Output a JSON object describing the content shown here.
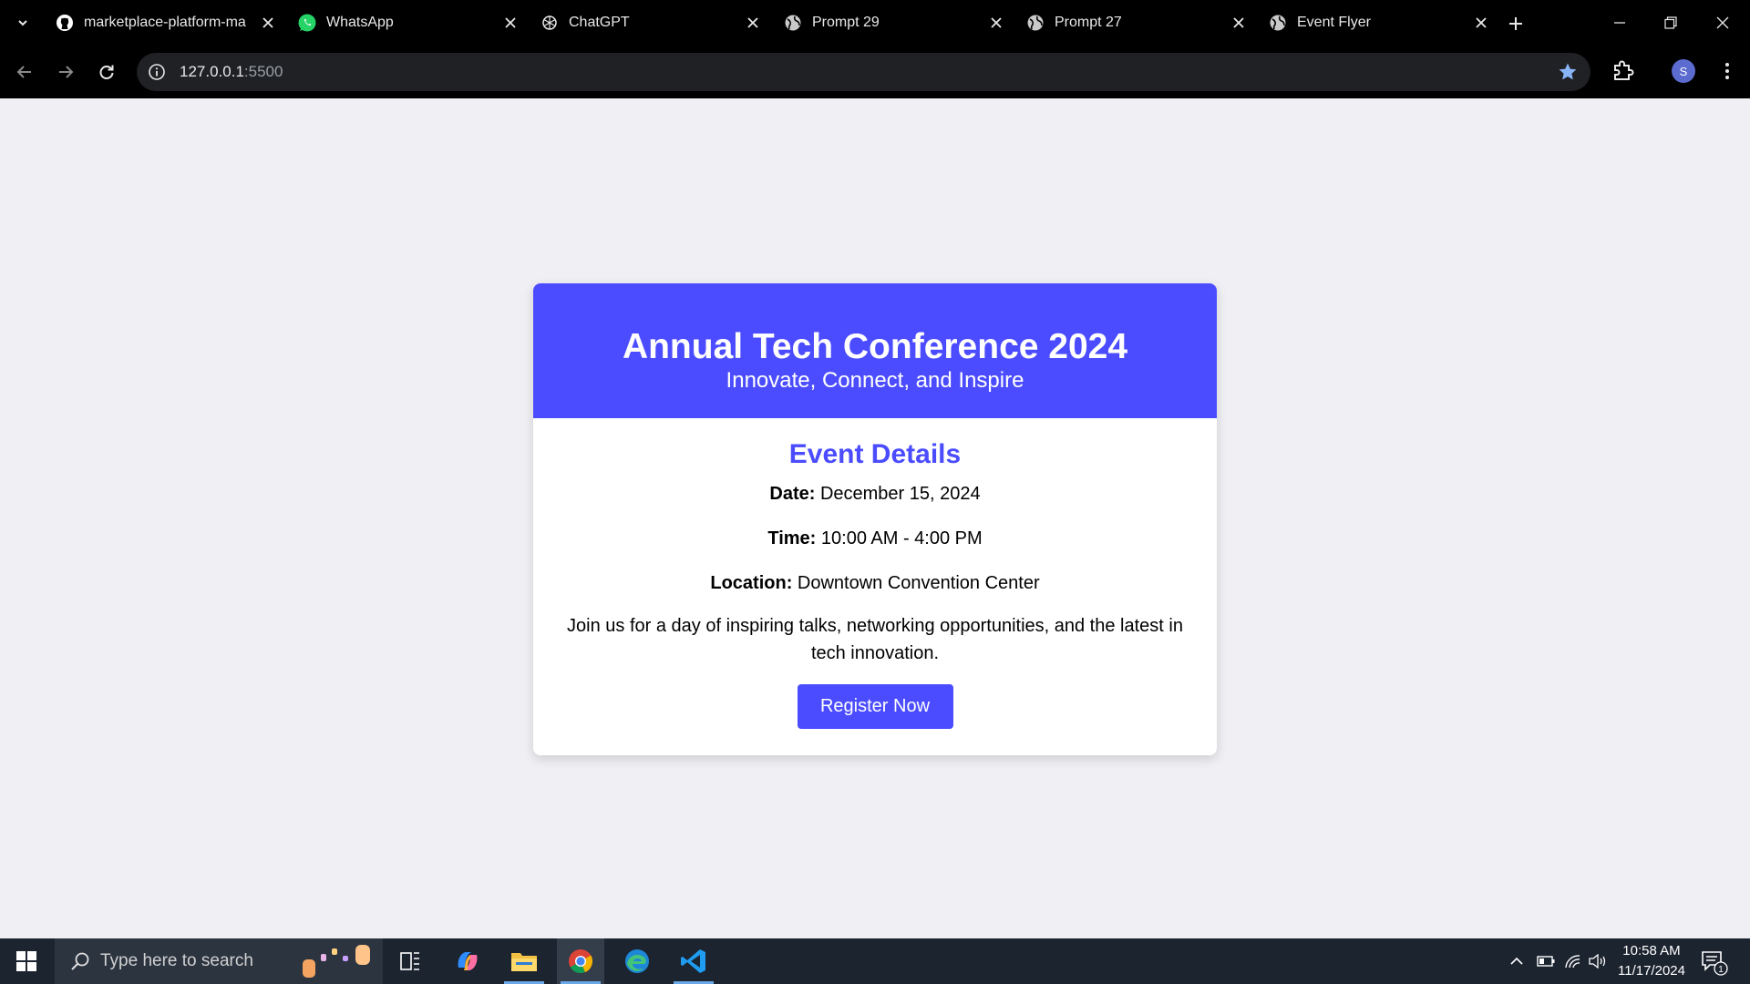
{
  "browser": {
    "tabs": [
      {
        "title": "marketplace-platform-main",
        "icon": "github-icon"
      },
      {
        "title": "WhatsApp",
        "icon": "whatsapp-icon"
      },
      {
        "title": "ChatGPT",
        "icon": "chatgpt-icon"
      },
      {
        "title": "Prompt 29",
        "icon": "globe-icon"
      },
      {
        "title": "Prompt 27",
        "icon": "globe-icon"
      },
      {
        "title": "Event Flyer",
        "icon": "globe-icon"
      }
    ],
    "active_tab": "Event Flyer",
    "url_host": "127.0.0.1",
    "url_port": ":5500",
    "profile_initial": "S",
    "accent_color": "#8ab4f8"
  },
  "flyer": {
    "title": "Annual Tech Conference 2024",
    "subtitle": "Innovate, Connect, and Inspire",
    "section_title": "Event Details",
    "date_label": "Date:",
    "date_value": "December 15, 2024",
    "time_label": "Time:",
    "time_value": "10:00 AM - 4:00 PM",
    "location_label": "Location:",
    "location_value": "Downtown Convention Center",
    "description": "Join us for a day of inspiring talks, networking opportunities, and the latest in tech innovation.",
    "register_label": "Register Now",
    "brand_color": "#4b4cff"
  },
  "taskbar": {
    "search_placeholder": "Type here to search",
    "apps": [
      "task-view",
      "copilot",
      "file-explorer",
      "chrome",
      "edge",
      "vscode"
    ],
    "active_app": "chrome",
    "time": "10:58 AM",
    "date": "11/17/2024",
    "notification_count": "1"
  }
}
